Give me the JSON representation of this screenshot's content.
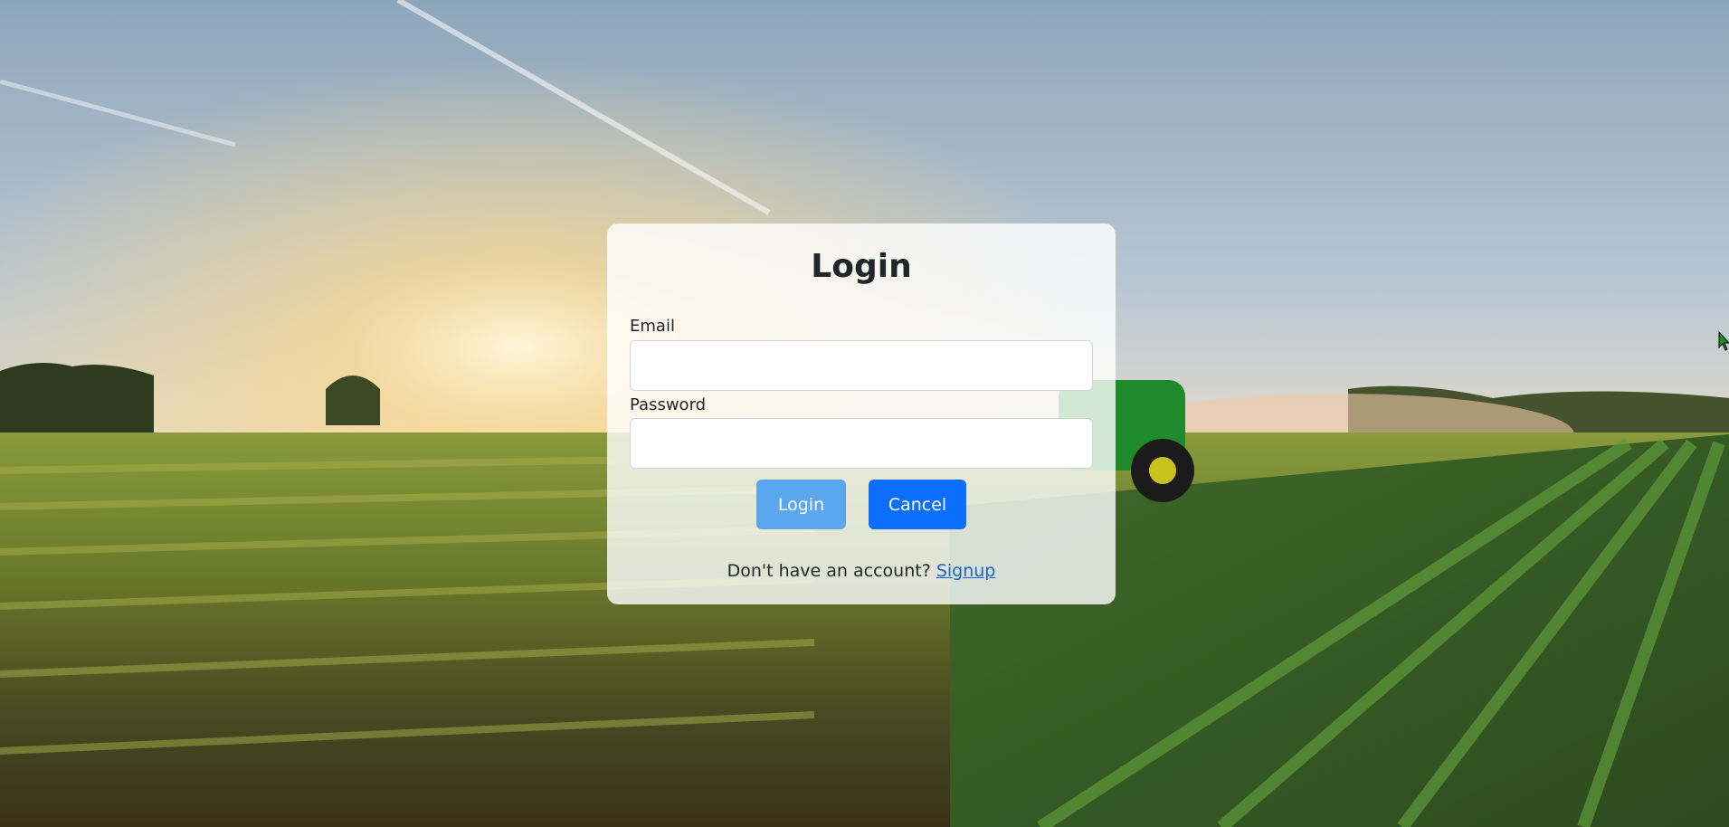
{
  "page": {
    "background_scene": "farm-field-with-tractor"
  },
  "login_card": {
    "title": "Login",
    "email_label": "Email",
    "email_value": "",
    "password_label": "Password",
    "password_value": "",
    "login_button": "Login",
    "cancel_button": "Cancel",
    "signup_prompt": "Don't have an account?",
    "signup_link": "Signup"
  },
  "colors": {
    "login_button": "#5aa6ef",
    "cancel_button": "#0b6efd",
    "link": "#1a63d8",
    "text": "#212529"
  }
}
